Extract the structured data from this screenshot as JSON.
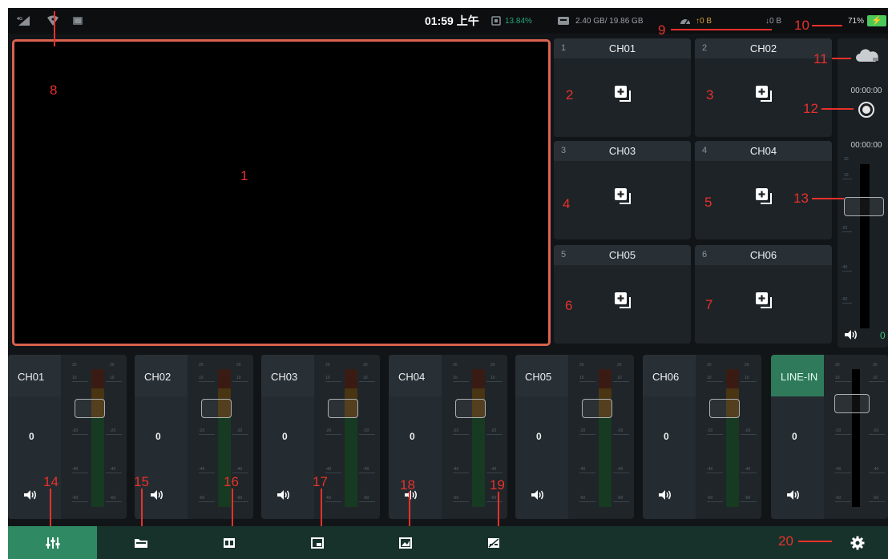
{
  "status_bar": {
    "signal_badge": "4G",
    "time": "01:59 上午",
    "cpu": "13.84%",
    "memory": "2.40 GB/ 19.86 GB",
    "upload": "↑0 B",
    "download": "↓0 B",
    "battery": "71%",
    "icons": [
      "signal-icon",
      "wifi-icon",
      "image-icon",
      "cpu-icon",
      "memory-icon",
      "speedometer-icon",
      "battery-charging-icon"
    ]
  },
  "tiles": [
    {
      "index": "1",
      "name": "CH01"
    },
    {
      "index": "2",
      "name": "CH02"
    },
    {
      "index": "3",
      "name": "CH03"
    },
    {
      "index": "4",
      "name": "CH04"
    },
    {
      "index": "5",
      "name": "CH05"
    },
    {
      "index": "6",
      "name": "CH06"
    }
  ],
  "side_panel": {
    "stream_time": "00:00:00",
    "record_time": "00:00:00",
    "gain": "0",
    "ticks": [
      "20",
      "10",
      "-20",
      "-40",
      "-60"
    ]
  },
  "mixer": [
    {
      "name": "CH01",
      "gain": "0"
    },
    {
      "name": "CH02",
      "gain": "0"
    },
    {
      "name": "CH03",
      "gain": "0"
    },
    {
      "name": "CH04",
      "gain": "0"
    },
    {
      "name": "CH05",
      "gain": "0"
    },
    {
      "name": "CH06",
      "gain": "0"
    },
    {
      "name": "LINE-IN",
      "gain": "0"
    }
  ],
  "meter_ticks": [
    "20",
    "10",
    "-20",
    "-40",
    "-60"
  ],
  "toolbar": {
    "icons": [
      "mixer-icon",
      "folder-icon",
      "layout-icon",
      "picture-in-picture-icon",
      "image-overlay-icon",
      "subtitle-icon",
      "settings-icon"
    ]
  },
  "annotations": [
    "1",
    "2",
    "3",
    "4",
    "5",
    "6",
    "7",
    "8",
    "9",
    "10",
    "11",
    "12",
    "13",
    "14",
    "15",
    "16",
    "17",
    "18",
    "19",
    "20"
  ],
  "colors": {
    "accent": "#2f8a63",
    "preview_border": "#d9624f",
    "annotation": "#e8312b",
    "cpu_text": "#27a57b",
    "upload_text": "#d9a032",
    "battery": "#4ac95a"
  }
}
